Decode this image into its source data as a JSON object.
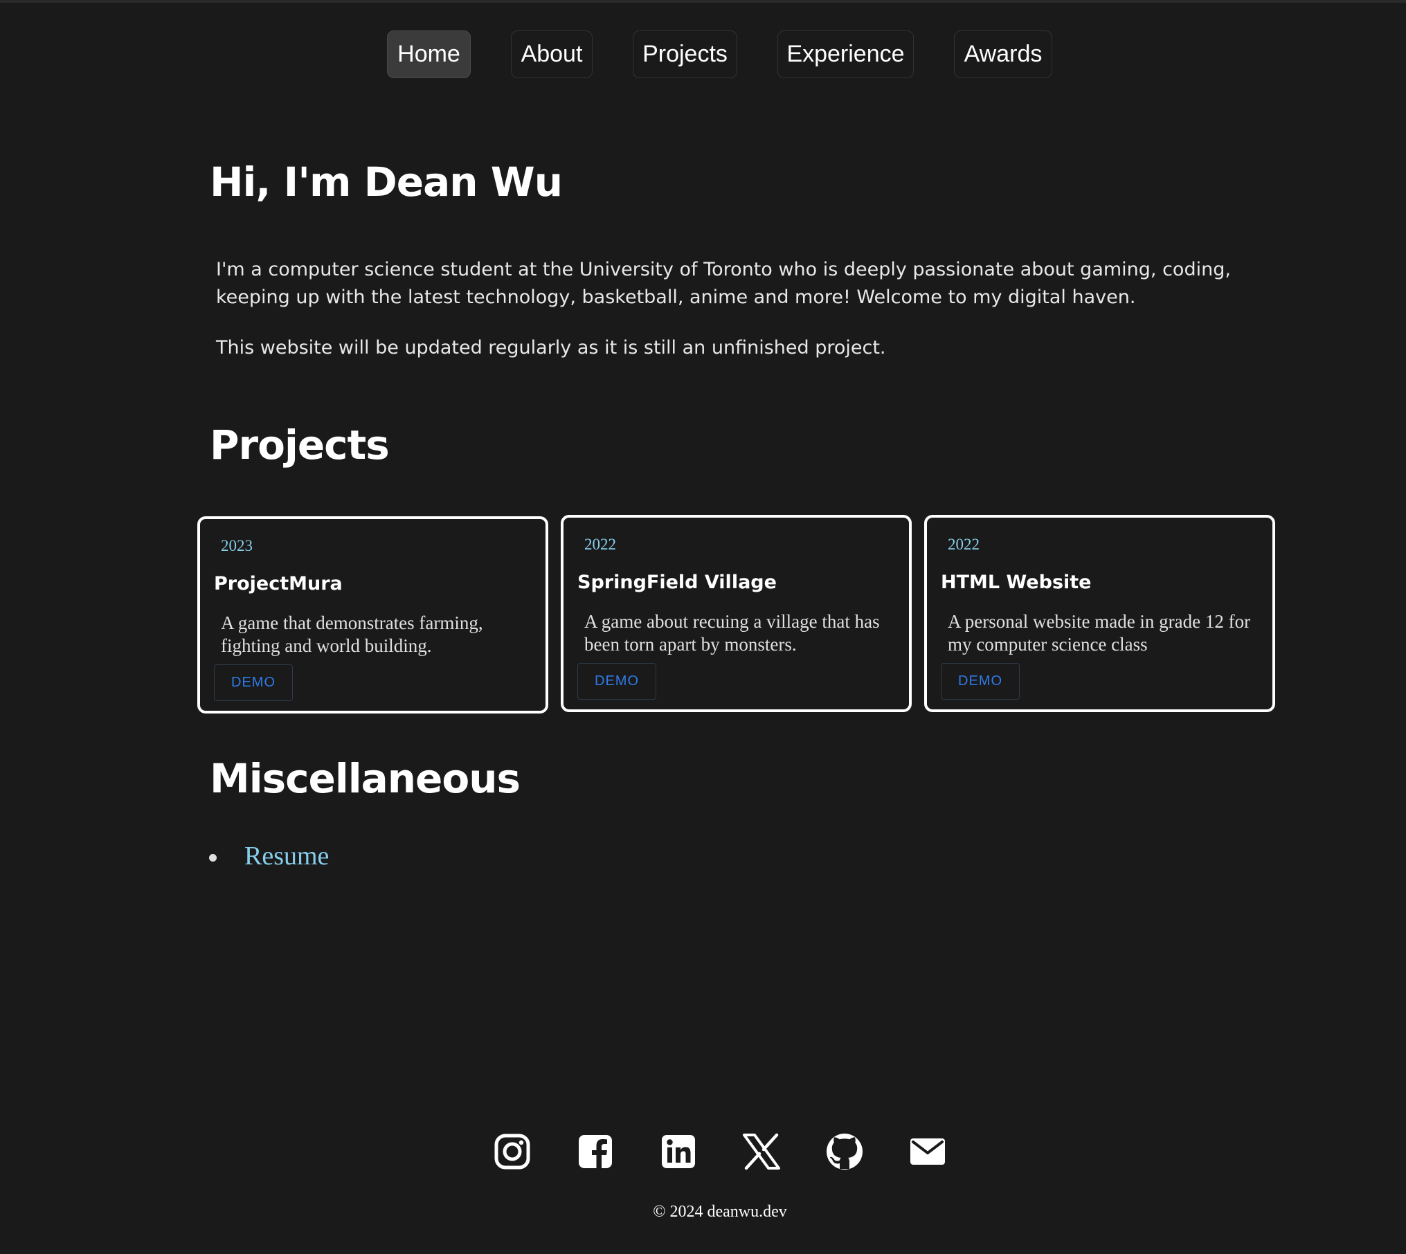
{
  "nav": {
    "items": [
      {
        "label": "Home",
        "active": true
      },
      {
        "label": "About",
        "active": false
      },
      {
        "label": "Projects",
        "active": false
      },
      {
        "label": "Experience",
        "active": false
      },
      {
        "label": "Awards",
        "active": false
      }
    ]
  },
  "hero": {
    "title": "Hi, I'm Dean Wu",
    "paragraph1": "I'm a computer science student at the University of Toronto who is deeply passionate about gaming, coding, keeping up with the latest technology, basketball, anime and more! Welcome to my digital haven.",
    "paragraph2": "This website will be updated regularly as it is still an unfinished project."
  },
  "projects": {
    "heading": "Projects",
    "items": [
      {
        "year": "2023",
        "title": "ProjectMura",
        "description": "A game that demonstrates farming, fighting and world building.",
        "button": "DEMO"
      },
      {
        "year": "2022",
        "title": "SpringField Village",
        "description": "A game about recuing a village that has been torn apart by monsters.",
        "button": "DEMO"
      },
      {
        "year": "2022",
        "title": "HTML Website",
        "description": "A personal website made in grade 12 for my computer science class",
        "button": "DEMO"
      }
    ]
  },
  "misc": {
    "heading": "Miscellaneous",
    "links": [
      "Resume"
    ]
  },
  "footer": {
    "socials": [
      "instagram-icon",
      "facebook-icon",
      "linkedin-icon",
      "x-icon",
      "github-icon",
      "mail-icon"
    ],
    "copyright": "© 2024 deanwu.dev"
  },
  "colors": {
    "background": "#1a1a1a",
    "accent_link": "#87ceeb",
    "demo_button": "#2f7be8",
    "card_border": "#ffffff"
  }
}
